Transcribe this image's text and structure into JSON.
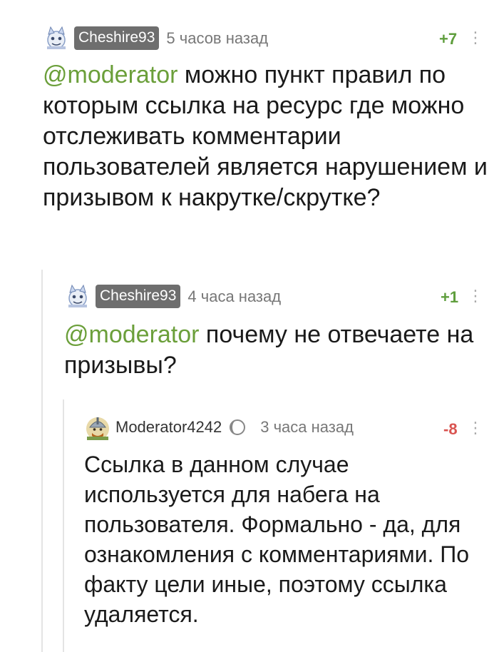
{
  "comments": [
    {
      "username": "Cheshire93",
      "time": "5 часов назад",
      "rating": "+7",
      "mention": "@moderator",
      "body": " можно пункт правил по которым ссылка на ресурс где можно отслеживать комментарии пользователей является нарушением и призывом к накрутке/скрутке?"
    },
    {
      "username": "Cheshire93",
      "time": "4 часа назад",
      "rating": "+1",
      "mention": "@moderator",
      "body": " почему не отвечаете на призывы?"
    },
    {
      "username": "Moderator4242",
      "time": "3 часа назад",
      "rating": "-8",
      "body": "Ссылка в данном случае используется для набега на пользователя. Формально - да, для ознакомления с комментариями. По факту цели иные, поэтому ссылка удаляется."
    }
  ],
  "colors": {
    "positive_rating": "#5f9e3d",
    "negative_rating": "#d9534f",
    "mention": "#6b9f3a",
    "badge_bg": "#6e6e6e"
  },
  "icons": {
    "avatar_cheshire": "cat-avatar-icon",
    "avatar_moderator": "knight-avatar-icon",
    "moderator_badge": "moderator-moon-icon",
    "more": "more-vertical-icon"
  }
}
